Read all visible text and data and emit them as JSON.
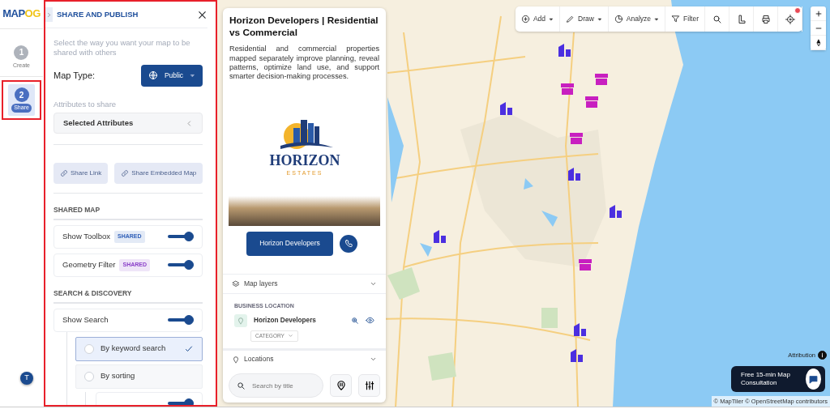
{
  "app": {
    "logo": "MAPOG",
    "user_initial": "T"
  },
  "steps": [
    {
      "number": "1",
      "label": "Create",
      "selected": false
    },
    {
      "number": "2",
      "label": "Share",
      "selected": true
    }
  ],
  "panel": {
    "title": "SHARE AND PUBLISH",
    "intro": "Select the way you want your map to be shared with others",
    "map_type_label": "Map Type:",
    "map_type_value": "Public",
    "attributes_label": "Attributes to share",
    "attributes_select": "Selected Attributes",
    "share_buttons": [
      "Share Link",
      "Share Embedded Map"
    ],
    "sections": [
      {
        "heading": "SHARED MAP",
        "items": [
          {
            "label": "Show Toolbox",
            "badge": "SHARED",
            "color": "#2f5fb8",
            "on": true
          },
          {
            "label": "Geometry Filter",
            "badge": "SHARED",
            "color": "#8a3fc9",
            "on": true
          }
        ]
      },
      {
        "heading": "SEARCH & DISCOVERY",
        "items": [
          {
            "label": "Show Search",
            "on": true,
            "options": [
              {
                "label": "By keyword search",
                "selected": true
              },
              {
                "label": "By sorting",
                "selected": false
              }
            ],
            "sub_toggle": {
              "on": true
            }
          }
        ]
      }
    ]
  },
  "story": {
    "title": "Horizon Developers | Residential vs Commercial",
    "description": "Residential and commercial properties mapped separately improve planning, reveal patterns, optimize land use, and support smarter decision-making processes.",
    "logo_name": "HORIZON",
    "logo_tagline": "ESTATES",
    "button": "Horizon Developers",
    "layers": {
      "title": "Map layers",
      "group": "BUSINESS LOCATION",
      "layer": "Horizon Developers",
      "category": "CATEGORY"
    },
    "locations": {
      "title": "Locations",
      "search_placeholder": "Search by title"
    }
  },
  "toolbar": [
    {
      "label": "Add",
      "dropdown": true
    },
    {
      "label": "Draw",
      "dropdown": true
    },
    {
      "label": "Analyze",
      "dropdown": true
    },
    {
      "label": "Filter",
      "dropdown": false
    }
  ],
  "markers": [
    {
      "kind": "residential"
    },
    {
      "kind": "residential"
    },
    {
      "kind": "residential"
    },
    {
      "kind": "residential"
    },
    {
      "kind": "residential"
    },
    {
      "kind": "residential"
    },
    {
      "kind": "residential"
    },
    {
      "kind": "commercial"
    },
    {
      "kind": "commercial"
    },
    {
      "kind": "commercial"
    },
    {
      "kind": "commercial"
    },
    {
      "kind": "commercial"
    }
  ],
  "attribution": "Attribution",
  "consultation": "Free 15-min Map Consultation",
  "copyright": "© MapTiler © OpenStreetMap contributors"
}
